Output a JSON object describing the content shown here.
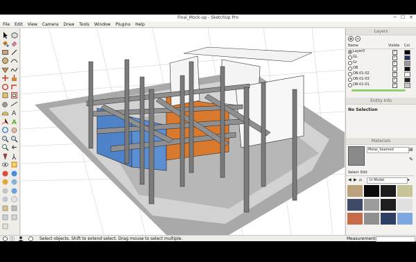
{
  "window": {
    "title": "Final_Mock-up - SketchUp Pro",
    "minimize": "─",
    "maximize": "☐",
    "close": "✕"
  },
  "menu": [
    "File",
    "Edit",
    "View",
    "Camera",
    "Draw",
    "Tools",
    "Window",
    "Plugins",
    "Help"
  ],
  "layers": {
    "panel_title": "Layers",
    "col_name": "Name",
    "col_visible": "Visible",
    "col_color": "Col",
    "rows": [
      {
        "name": "Layer0",
        "visible": true,
        "active": true,
        "color": "#000000"
      },
      {
        "name": "GL",
        "visible": true,
        "active": false,
        "color": "#1f2f5e"
      },
      {
        "name": "Gr",
        "visible": true,
        "active": false,
        "color": "#9b9b9b"
      },
      {
        "name": "OB",
        "visible": false,
        "active": false,
        "color": "#111111"
      },
      {
        "name": "OB-01-02",
        "visible": true,
        "active": false,
        "color": "#f4f4f4"
      },
      {
        "name": "OB-01-03",
        "visible": true,
        "active": false,
        "color": "#222222"
      },
      {
        "name": "OB-01-01",
        "visible": true,
        "active": false,
        "color": "#cccccc"
      }
    ]
  },
  "entity_info": {
    "panel_title": "Entity Info",
    "selection": "No Selection"
  },
  "materials": {
    "panel_title": "Materials",
    "current_name": "Metal_Seamed",
    "tab_select": "Select",
    "tab_edit": "Edit",
    "library": "In Model",
    "swatches": [
      "#b9a27c",
      "#0b0b0b",
      "#1c1c1c",
      "#c8c49a",
      "#3f4a69",
      "#9c9c9c",
      "#1e1e1e",
      "#e0e0e0",
      "#c56b4a",
      "#8f8f8f",
      "#2d3f63",
      "#7ea6e0"
    ]
  },
  "status": {
    "hint": "Select objects. Shift to extend select. Drag mouse to select multiple.",
    "measurements_label": "Measurements",
    "measurements_value": ""
  },
  "tools": [
    "select-arrow",
    "component",
    "paint-bucket",
    "eraser",
    "rectangle",
    "line",
    "circle",
    "arc",
    "polygon",
    "freehand",
    "move",
    "push-pull",
    "rotate",
    "follow-me",
    "scale",
    "offset",
    "tape-measure",
    "dimension",
    "protractor",
    "text",
    "axes",
    "3d-text",
    "orbit",
    "pan",
    "zoom",
    "zoom-window",
    "zoom-extents",
    "previous",
    "position-camera",
    "walk",
    "look-around",
    "section-plane",
    "geo-location",
    "photo-textures",
    "shadows",
    "fog",
    "x-ray",
    "styles"
  ]
}
